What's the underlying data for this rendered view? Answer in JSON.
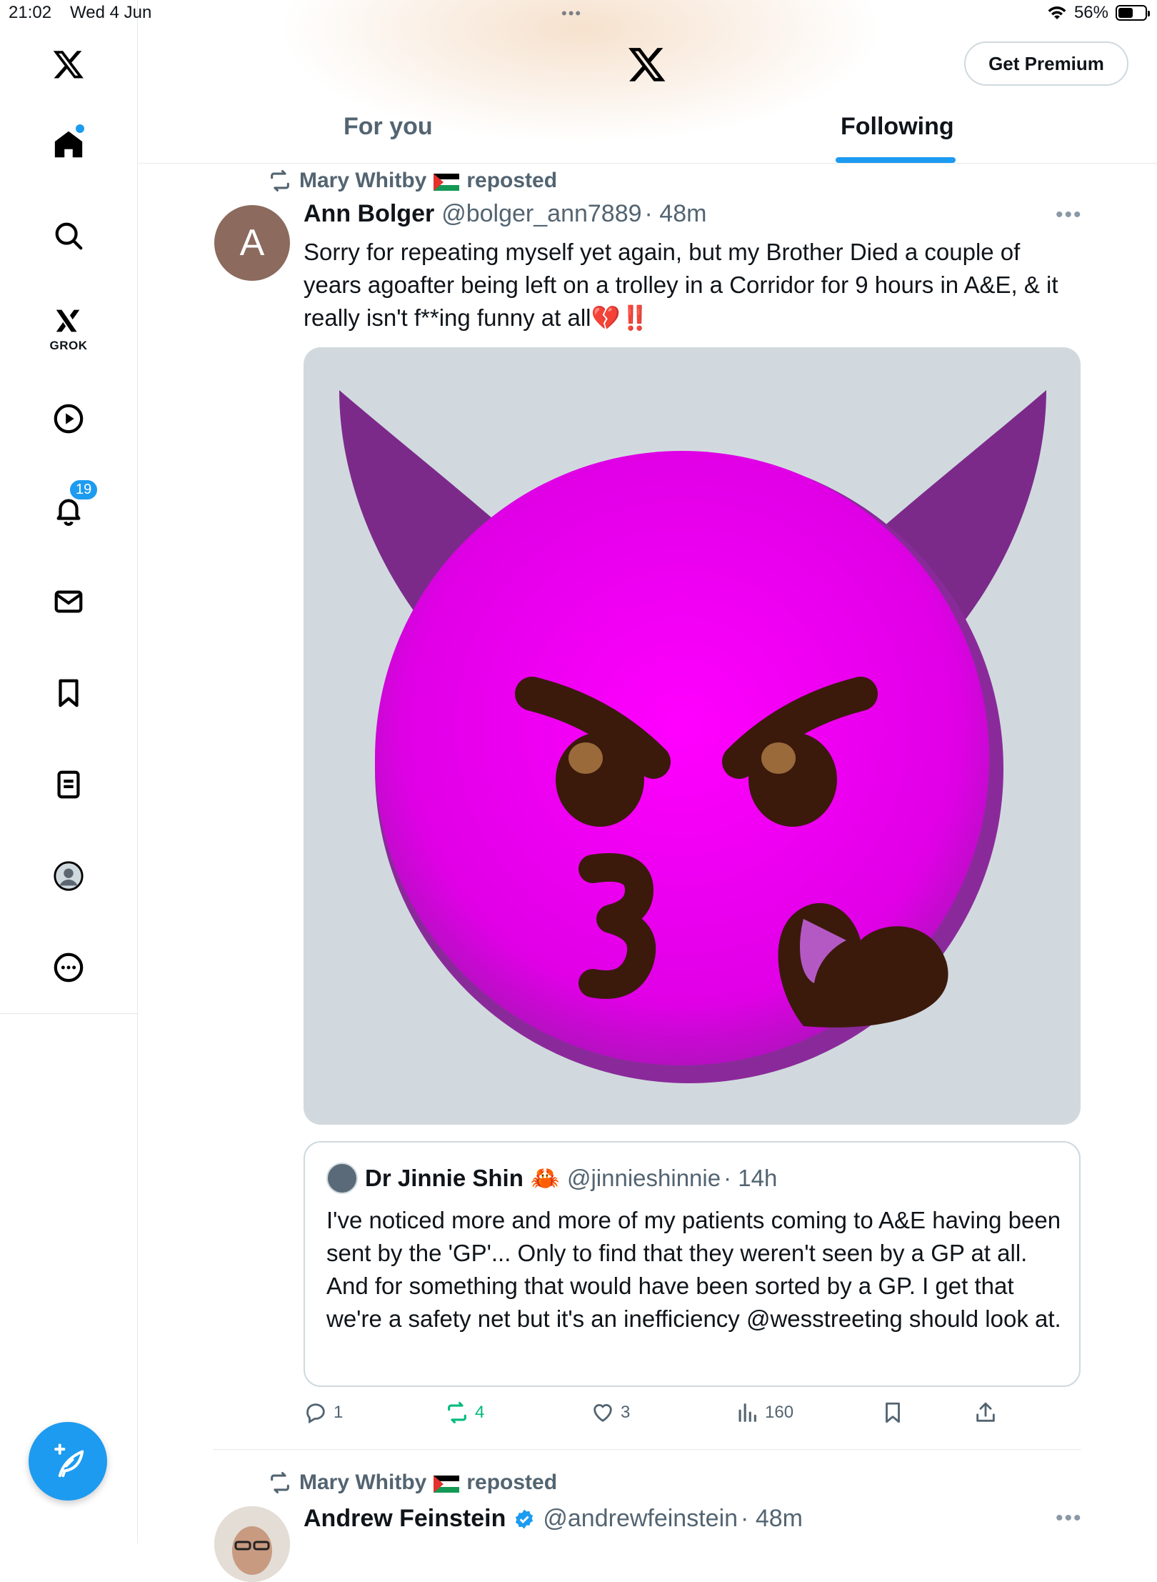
{
  "status_bar": {
    "time": "21:02",
    "date": "Wed 4 Jun",
    "battery": "56%",
    "battery_level": 0.56
  },
  "sidebar": {
    "grok_label": "GROK",
    "notifications_badge": "19"
  },
  "header": {
    "premium_label": "Get Premium",
    "tabs": [
      {
        "label": "For you"
      },
      {
        "label": "Following"
      }
    ],
    "active_tab": "Following"
  },
  "tweets": [
    {
      "reposted_by": "Mary Whitby",
      "reposted_label": "reposted",
      "avatar_letter": "A",
      "author": "Ann Bolger",
      "handle": "@bolger_ann7889",
      "time": "· 48m",
      "text": "Sorry for repeating myself yet again, but my Brother Died a couple of years agoafter being left on a trolley in a  Corridor for 9 hours in A&E, & it really isn't f**ing funny at all💔‼️",
      "quote": {
        "author": "Dr Jinnie Shin",
        "author_emoji": "🦀",
        "handle": "@jinnieshinnie",
        "time": "· 14h",
        "text": "I've noticed more and more of my patients coming to A&E having been sent by the 'GP'... Only to find that they weren't seen by a GP at all. And for something that would have been sorted by a GP. I get that we're a safety net but it's an inefficiency @wesstreeting should look at."
      },
      "replies": "1",
      "reposts": "4",
      "likes": "3",
      "views": "160"
    },
    {
      "reposted_by": "Mary Whitby",
      "reposted_label": "reposted",
      "author": "Andrew Feinstein",
      "handle": "@andrewfeinstein",
      "time": "· 48m"
    }
  ],
  "colors": {
    "accent": "#1d9bf0",
    "repost_green": "#00ba7c",
    "emoji_magenta": "#ff00ff",
    "horn_purple": "#7b2a8a"
  }
}
